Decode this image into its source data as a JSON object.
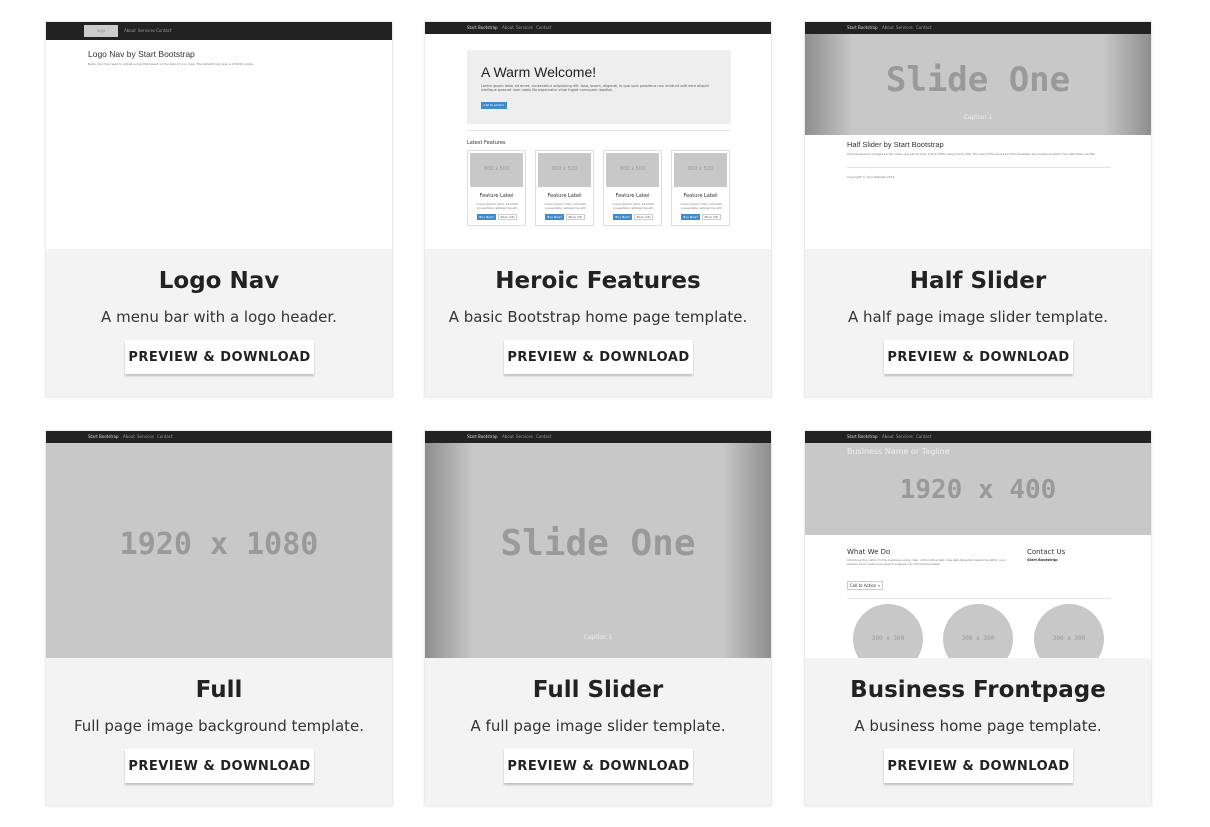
{
  "cards": [
    {
      "title": "Logo Nav",
      "desc": "A menu bar with a logo header.",
      "button": "PREVIEW & DOWNLOAD",
      "thumb": {
        "nav_logo": "logo",
        "nav_items": [
          "About",
          "Services",
          "Contact"
        ],
        "heading": "Logo Nav by Start Bootstrap",
        "note": "Note: You may need to adjust some CSS based on the size of your logo. The default logo size is 150x50 pixels."
      }
    },
    {
      "title": "Heroic Features",
      "desc": "A basic Bootstrap home page template.",
      "button": "PREVIEW & DOWNLOAD",
      "thumb": {
        "brand": "Start Bootstrap",
        "nav_items": [
          "About",
          "Services",
          "Contact"
        ],
        "welcome": "A Warm Welcome!",
        "welcome_text": "Lorem ipsum dolor sit amet, consectetur adipisicing elit. Ipsa, ipsam, eligendi, in quo sunt possimus non incidunt odit vero aliquid similique quaerat nam nobis illo aspernatur vitae fugiat numquam repellat.",
        "cta": "Call to action!",
        "latest": "Latest Features",
        "feature_img": "800 x 500",
        "feature_label": "Feature Label",
        "feature_text": "Lorem ipsum dolor sit amet, consectetur adipisicing elit.",
        "buy": "Buy Now!",
        "more": "More Info"
      }
    },
    {
      "title": "Half Slider",
      "desc": "A half page image slider template.",
      "button": "PREVIEW & DOWNLOAD",
      "thumb": {
        "brand": "Start Bootstrap",
        "nav_items": [
          "About",
          "Services",
          "Contact"
        ],
        "slide": "Slide One",
        "caption": "Caption 1",
        "heading": "Half Slider by Start Bootstrap",
        "text": "The background images for the slider are set directly in the HTML using inline CSS. The rest of the styles for this template are contained within the half-slider.css file.",
        "footer": "Copyright © Your Website 2014"
      }
    },
    {
      "title": "Full",
      "desc": "Full page image background template.",
      "button": "PREVIEW & DOWNLOAD",
      "thumb": {
        "brand": "Start Bootstrap",
        "nav_items": [
          "About",
          "Services",
          "Contact"
        ],
        "placeholder": "1920 x 1080"
      }
    },
    {
      "title": "Full Slider",
      "desc": "A full page image slider template.",
      "button": "PREVIEW & DOWNLOAD",
      "thumb": {
        "brand": "Start Bootstrap",
        "nav_items": [
          "About",
          "Services",
          "Contact"
        ],
        "slide": "Slide One",
        "caption": "Caption 1"
      }
    },
    {
      "title": "Business Frontpage",
      "desc": "A business home page template.",
      "button": "PREVIEW & DOWNLOAD",
      "thumb": {
        "brand": "Start Bootstrap",
        "nav_items": [
          "About",
          "Services",
          "Contact"
        ],
        "tagline": "Business Name or Tagline",
        "placeholder": "1920 x 400",
        "what": "What We Do",
        "what_text": "Introduce the visitor to the business using clear, informative text. Use well-targeted keywords within your sentences to make sure search engines can find the business.",
        "cta": "Call to Action »",
        "contact": "Contact Us",
        "contact_name": "Start Bootstrap",
        "circle": "300 x 300"
      }
    }
  ]
}
